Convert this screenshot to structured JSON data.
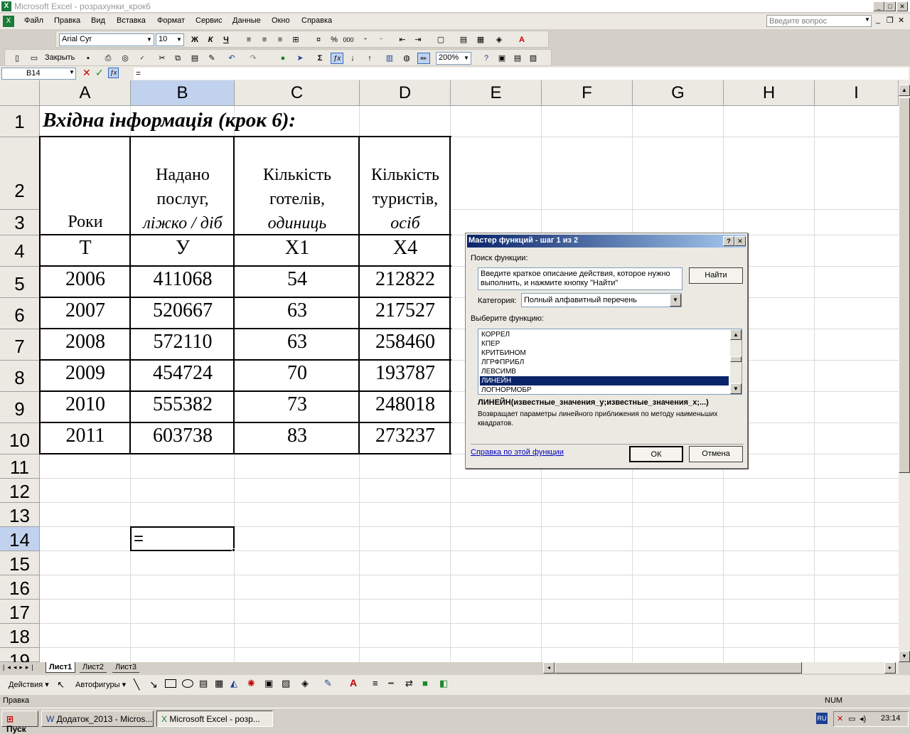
{
  "app": {
    "title": "Microsoft Excel - розрахунки_крок6"
  },
  "menu": [
    "Файл",
    "Правка",
    "Вид",
    "Вставка",
    "Формат",
    "Сервис",
    "Данные",
    "Окно",
    "Справка"
  ],
  "help_placeholder": "Введите вопрос",
  "format_toolbar": {
    "font": "Arial Cyr",
    "size": "10",
    "bold": "Ж",
    "italic": "К",
    "underline": "Ч",
    "percent": "%",
    "thousands": "000"
  },
  "std_toolbar": {
    "close_label": "Закрыть",
    "zoom": "200%",
    "sigma": "Σ"
  },
  "formula_bar": {
    "name_box": "B14",
    "formula": "="
  },
  "columns": [
    "A",
    "B",
    "C",
    "D",
    "E",
    "F",
    "G",
    "H",
    "I"
  ],
  "rows": [
    "1",
    "2",
    "3",
    "4",
    "5",
    "6",
    "7",
    "8",
    "9",
    "10",
    "11",
    "12",
    "13",
    "14",
    "15",
    "16",
    "17",
    "18",
    "19"
  ],
  "sheet": {
    "title": "Вхідна інформація (крок 6):",
    "headers": {
      "a": "Роки",
      "b1": "Надано",
      "b2": "послуг,",
      "b3": "ліжко / діб",
      "c1": "Кількість",
      "c2": "готелів,",
      "c3": "одиниць",
      "d1": "Кількість",
      "d2": "туристів,",
      "d3": "осіб"
    },
    "symbols": [
      "T",
      "У",
      "X1",
      "X4"
    ],
    "data": [
      [
        "2006",
        "411068",
        "54",
        "212822"
      ],
      [
        "2007",
        "520667",
        "63",
        "217527"
      ],
      [
        "2008",
        "572110",
        "63",
        "258460"
      ],
      [
        "2009",
        "454724",
        "70",
        "193787"
      ],
      [
        "2010",
        "555382",
        "73",
        "248018"
      ],
      [
        "2011",
        "603738",
        "83",
        "273237"
      ]
    ],
    "active_cell_value": "="
  },
  "sheet_tabs": [
    "Лист1",
    "Лист2",
    "Лист3"
  ],
  "draw_toolbar": {
    "actions": "Действия",
    "autoshapes": "Автофигуры"
  },
  "status": {
    "mode": "Правка",
    "num": "NUM"
  },
  "taskbar": {
    "start": "Пуск",
    "task1": "Додаток_2013 - Micros...",
    "task2": "Microsoft Excel - розр...",
    "lang": "RU",
    "clock": "23:14"
  },
  "dialog": {
    "title": "Мастер функций - шаг 1 из 2",
    "search_label": "Поиск функции:",
    "search_text": "Введите краткое описание действия, которое нужно выполнить, и нажмите кнопку \"Найти\"",
    "find_button": "Найти",
    "category_label": "Категория:",
    "category_value": "Полный алфавитный перечень",
    "select_label": "Выберите функцию:",
    "functions": [
      "КОРРЕЛ",
      "КПЕР",
      "КРИТБИНОМ",
      "ЛГРФПРИБЛ",
      "ЛЕВСИМВ",
      "ЛИНЕЙН",
      "ЛОГНОРМОБР"
    ],
    "selected_function": "ЛИНЕЙН",
    "signature": "ЛИНЕЙН(известные_значения_y;известные_значения_x;...)",
    "description": "Возвращает параметры линейного приближения по методу наименьших квадратов.",
    "help_link": "Справка по этой функции",
    "ok": "ОК",
    "cancel": "Отмена"
  }
}
